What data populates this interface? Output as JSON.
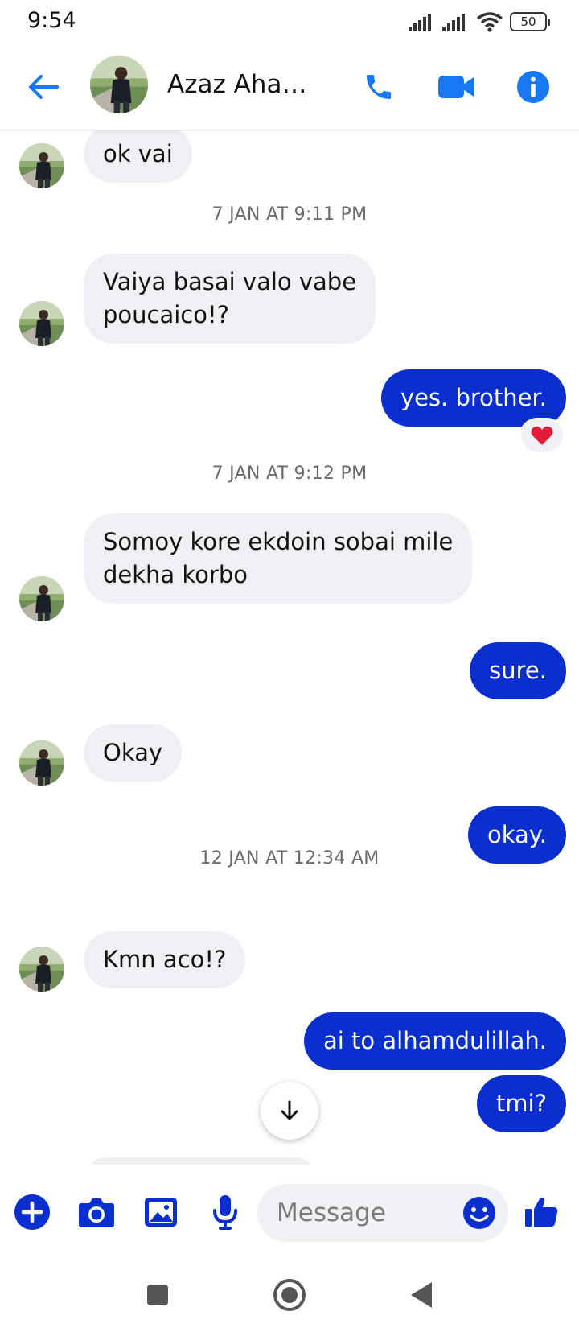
{
  "status_bar": {
    "time": "9:54",
    "battery": "50"
  },
  "header": {
    "contact_name": "Azaz Aham..."
  },
  "messages": [
    {
      "text": "ok vai"
    },
    {
      "text": "7 JAN AT 9:11 PM"
    },
    {
      "text": "Vaiya basai valo vabe\npoucaico!?"
    },
    {
      "text": "yes. brother."
    },
    {
      "text": "7 JAN AT 9:12 PM"
    },
    {
      "text": "Somoy kore ekdoin sobai mile\ndekha korbo"
    },
    {
      "text": "sure."
    },
    {
      "text": "Okay"
    },
    {
      "text": "okay."
    },
    {
      "text": "12 JAN AT 12:34 AM"
    },
    {
      "text": "Kmn aco!?"
    },
    {
      "text": "ai to alhamdulillah."
    },
    {
      "text": "tmi?"
    }
  ],
  "composer": {
    "placeholder": "Message"
  },
  "colors": {
    "accent": "#1877f2",
    "sent_bubble": "#0a2fce",
    "received_bubble": "#eff0f4"
  },
  "icons": [
    "back-arrow-icon",
    "phone-icon",
    "video-icon",
    "info-icon",
    "heart-icon",
    "arrow-down-icon",
    "plus-icon",
    "camera-icon",
    "image-icon",
    "microphone-icon",
    "smiley-icon",
    "thumbs-up-icon",
    "home-icon",
    "recents-icon",
    "back-icon"
  ]
}
